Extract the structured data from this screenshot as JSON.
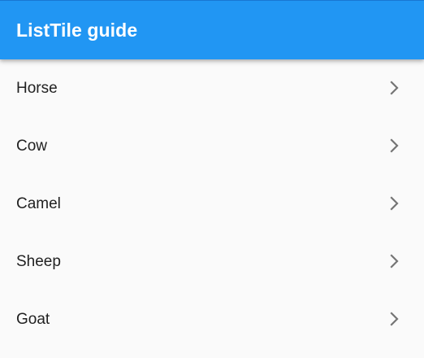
{
  "app": {
    "title": "ListTile guide",
    "colors": {
      "primary": "#2196f3",
      "background": "#fafafa",
      "text": "#212121",
      "chevron": "#757575"
    }
  },
  "list": {
    "items": [
      {
        "label": "Horse",
        "trailing_icon": "chevron-right-icon"
      },
      {
        "label": "Cow",
        "trailing_icon": "chevron-right-icon"
      },
      {
        "label": "Camel",
        "trailing_icon": "chevron-right-icon"
      },
      {
        "label": "Sheep",
        "trailing_icon": "chevron-right-icon"
      },
      {
        "label": "Goat",
        "trailing_icon": "chevron-right-icon"
      }
    ]
  }
}
